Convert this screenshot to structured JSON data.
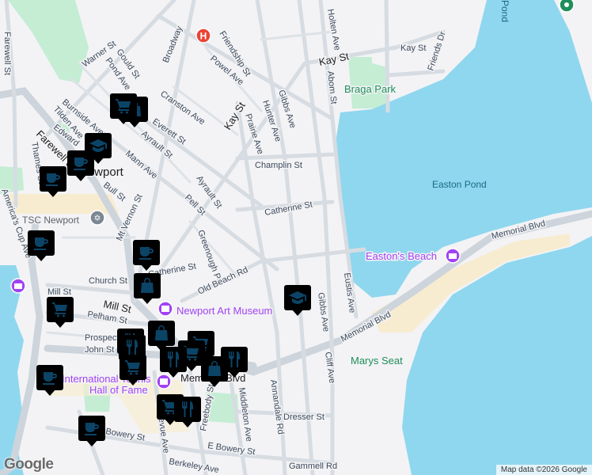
{
  "map": {
    "labels": [
      "Farewell St",
      "Warner St",
      "Gould St",
      "Pond Ave",
      "Broadway",
      "Friendship St",
      "Powel Ave",
      "Cranston Ave",
      "Kay St",
      "Prairie Ave",
      "Hunter Ave",
      "Gibbs Ave",
      "Champlin St",
      "Catherine St",
      "Everett St",
      "Ayrault St",
      "Ayrault St",
      "Mann Ave",
      "Burnside Ave",
      "Tilden Ave",
      "Edward",
      "Farewell St",
      "Thames St",
      "Newport",
      "Bull St",
      "Mt Vernon St",
      "Pell St",
      "Greenough Pl",
      "TSC Newport",
      "America's Cup Ave",
      "Church St",
      "Catherine St",
      "Old Beach Rd",
      "Mill St",
      "Mill St",
      "Pelham St",
      "Prospect",
      "John St",
      "Newport Art Museum",
      "International Tennis",
      "Hall of Fame",
      "Memorial Blvd",
      "Freebody St",
      "Middleton Ave",
      "Annandale Rd",
      "Bellevue Ave",
      "Dresser St",
      "Bowery St",
      "E Bowery St",
      "Berkeley Ave",
      "Gammell Rd",
      "Eustis Ave",
      "Gibbs Ave",
      "Cliff Ave",
      "Memorial Blvd",
      "Memorial Blvd",
      "Easton's Beach",
      "Easton Pond",
      "Marys Seat",
      "Braga Park",
      "Kay St",
      "Kay St",
      "Holten Ave",
      "Abom St",
      "Friends Dr",
      "Pond"
    ],
    "markers": [
      "cafe",
      "cafe",
      "school",
      "shopping-cart",
      "shopping-cart",
      "cafe",
      "cafe",
      "shopping-bag",
      "shopping-cart",
      "restaurant",
      "shopping-bag",
      "shopping-cart",
      "restaurant",
      "shopping-cart",
      "restaurant",
      "shopping-bag",
      "restaurant",
      "cafe",
      "shopping-cart",
      "restaurant",
      "cafe",
      "school",
      "hospital"
    ],
    "colors": {
      "water": "#8fd7ee",
      "park": "#c4edd4",
      "sand": "#f7ecd0",
      "marker": "#0b4466",
      "poi": "#a142f4",
      "hospital": "#ea4335"
    }
  },
  "footer": {
    "logo": "Google",
    "attribution": "Map data ©2026 Google"
  }
}
